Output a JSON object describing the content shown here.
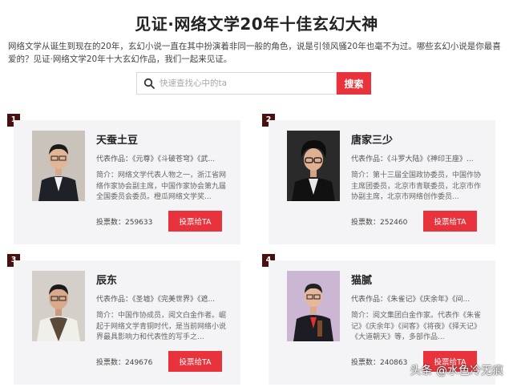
{
  "title": "见证·网络文学20年十佳玄幻大神",
  "intro": "网络文学从诞生到现在的20年，玄幻小说一直在其中扮演着非同一般的角色，说是引领风骚20年也毫不为过。哪些玄幻小说是你最喜爱的？见证·网络文学20年十大玄幻作品，我们一起来见证。",
  "search": {
    "placeholder": "快速查找心中的ta",
    "button_label": "搜索"
  },
  "colors": {
    "accent": "#e8323c",
    "rank_badge": "#4a0f0f",
    "card_bg": "#f4f4f6"
  },
  "authors": [
    {
      "rank": "1",
      "name": "天蚕土豆",
      "works": "代表作品：《元尊》《斗破苍穹》《武...",
      "intro": "简介：网络文学代表人物之一，浙江省网络作家协会副主席，中国作家协会第九届全国委员会委员。橙瓜网络文学奖...",
      "votes": "投票数：259633",
      "vote_button": "投票给TA"
    },
    {
      "rank": "2",
      "name": "唐家三少",
      "works": "代表作品：《斗罗大陆》《神印王座》...",
      "intro": "简介：第十三届全国政协委员，中国作协主席团委员，北京市青联委员，北京市作协副主席，北京市网络创作委员...",
      "votes": "投票数：252460",
      "vote_button": "投票给TA"
    },
    {
      "rank": "3",
      "name": "辰东",
      "works": "代表作品：《圣墟》《完美世界》《遮...",
      "intro": "简介：中国作协成员，阅文白金作者。崛起于网络文学青铜时代，是当前网络小说界最具影响力和代表性的写手之...",
      "votes": "投票数：249676",
      "vote_button": "投票给TA"
    },
    {
      "rank": "4",
      "name": "猫腻",
      "works": "代表作品：《朱雀记》《庆余年》《间...",
      "intro": "简介：阅文集团白金作家。代表作《朱雀记》《庆余年》《间客》《将夜》《择天记》《大道朝天》等，多部作品...",
      "votes": "投票数：240863",
      "vote_button": "投票给TA"
    }
  ],
  "watermark": "头条 @水色冷无痕"
}
